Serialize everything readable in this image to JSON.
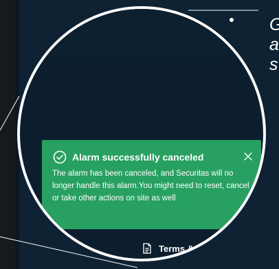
{
  "slide": {
    "bullet_text_lines": [
      "G",
      "a",
      "s"
    ]
  },
  "toast": {
    "title": "Alarm successfully canceled",
    "body": "The alarm has been canceled, and Securitas will no longer handle this alarm.You might need to reset, cancel or take other actions on site as well",
    "icon": "check-circle-icon",
    "close_icon": "close-icon",
    "color": "#27a061"
  },
  "footer": {
    "terms_label": "Terms & Cond"
  },
  "colors": {
    "background": "#0e2233",
    "lens_border": "#ffffff",
    "toast": "#27a061"
  }
}
